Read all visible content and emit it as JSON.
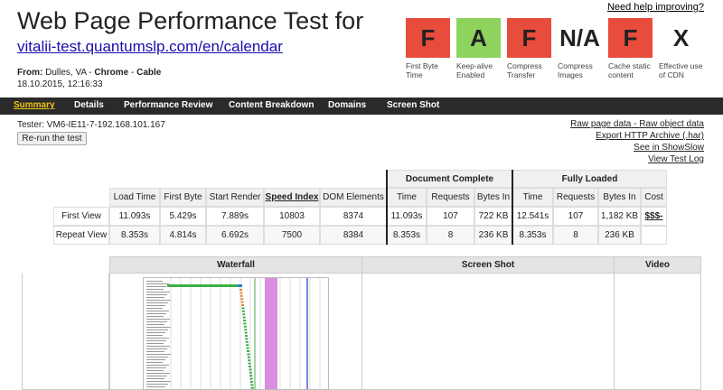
{
  "header": {
    "title": "Web Page Performance Test for",
    "url": "vitalii-test.quantumslp.com/en/calendar",
    "from_label": "From:",
    "from_location": "Dulles, VA -",
    "browser": "Chrome",
    "connection": "Cable",
    "date": "18.10.2015, 12:16:33",
    "help_link": "Need help improving?"
  },
  "grades": [
    {
      "grade": "F",
      "label": "First Byte Time",
      "color": "#e74c3c"
    },
    {
      "grade": "A",
      "label": "Keep-alive Enabled",
      "color": "#8fd35f"
    },
    {
      "grade": "F",
      "label": "Compress Transfer",
      "color": "#e74c3c"
    },
    {
      "grade": "N/A",
      "label": "Compress Images",
      "color": "#ffffff"
    },
    {
      "grade": "F",
      "label": "Cache static content",
      "color": "#e74c3c"
    },
    {
      "grade": "X",
      "label": "Effective use of CDN",
      "color": "#ffffff"
    }
  ],
  "nav": {
    "tabs": [
      "Summary",
      "Details",
      "Performance Review",
      "Content Breakdown",
      "Domains",
      "Screen Shot"
    ],
    "active": "Summary"
  },
  "tester": "Tester: VM6-IE11-7-192.168.101.167",
  "rerun_label": "Re-run the test",
  "right_links": {
    "raw_page_data": "Raw page data",
    "dash": "-",
    "raw_object_data": "Raw object data",
    "export_har": "Export HTTP Archive (.har)",
    "showslow": "See in ShowSlow",
    "view_log": "View Test Log"
  },
  "results": {
    "group_doc": "Document Complete",
    "group_full": "Fully Loaded",
    "columns": [
      "Load Time",
      "First Byte",
      "Start Render",
      "Speed Index",
      "DOM Elements",
      "Time",
      "Requests",
      "Bytes In",
      "Time",
      "Requests",
      "Bytes In",
      "Cost"
    ],
    "rows": [
      {
        "label": "First View",
        "cells": [
          "11.093s",
          "5.429s",
          "7.889s",
          "10803",
          "8374",
          "11.093s",
          "107",
          "722 KB",
          "12.541s",
          "107",
          "1,182 KB",
          "$$$-"
        ]
      },
      {
        "label": "Repeat View",
        "cells": [
          "8.353s",
          "4.814s",
          "6.692s",
          "7500",
          "8384",
          "8.353s",
          "8",
          "236 KB",
          "8.353s",
          "8",
          "236 KB",
          ""
        ]
      }
    ]
  },
  "sections": {
    "waterfall": "Waterfall",
    "screenshot": "Screen Shot",
    "video": "Video"
  }
}
